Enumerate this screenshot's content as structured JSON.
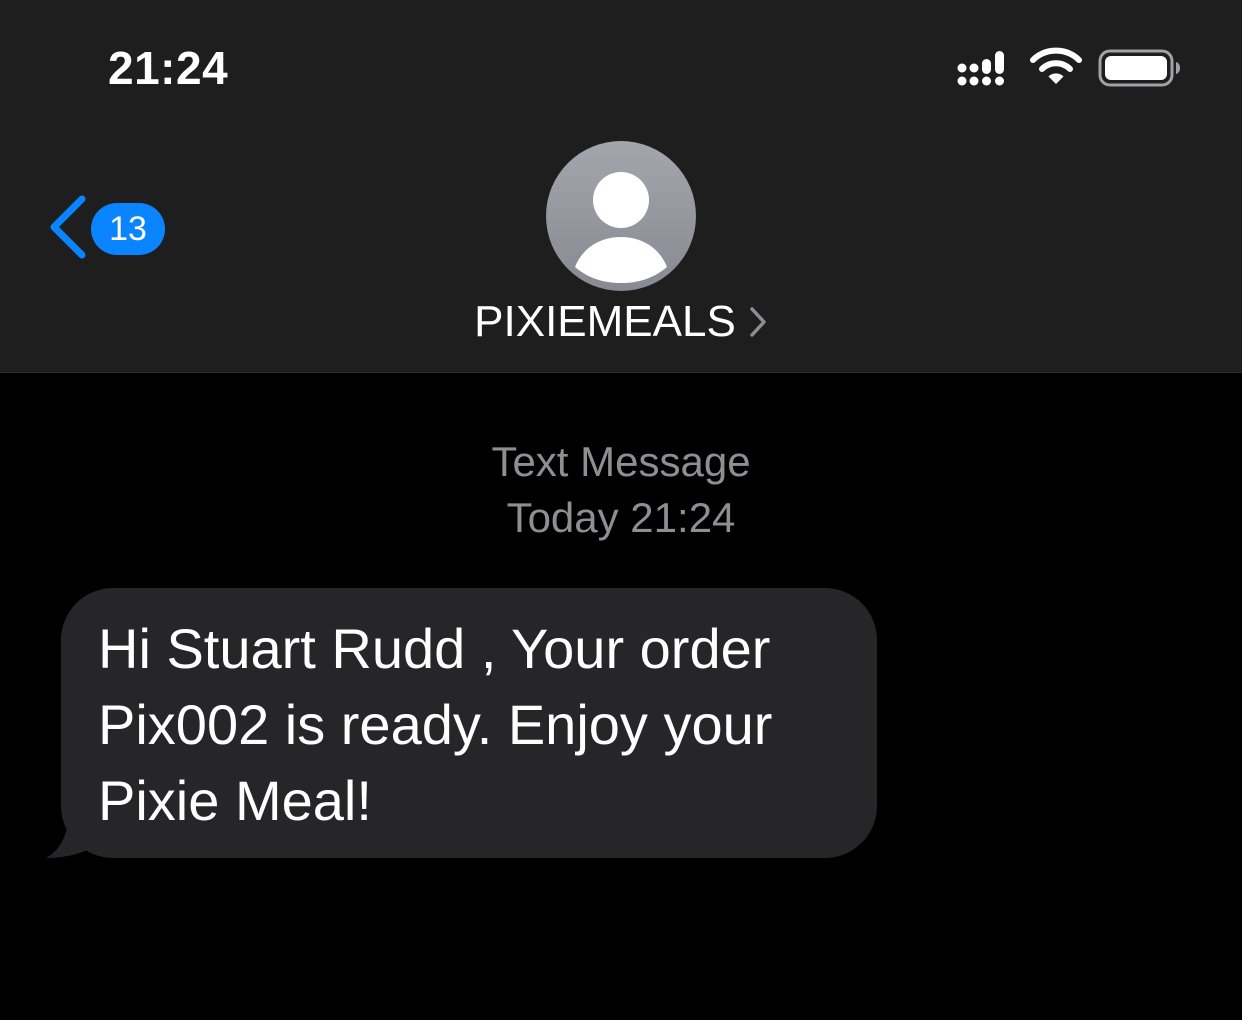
{
  "status_bar": {
    "time": "21:24",
    "icons": [
      "cellular-signal-icon",
      "wifi-icon",
      "battery-icon"
    ]
  },
  "nav": {
    "back_icon": "chevron-left-icon",
    "unread_count": "13",
    "contact_name": "PIXIEMEALS",
    "contact_avatar_icon": "person-silhouette-icon",
    "contact_detail_icon": "chevron-right-icon"
  },
  "conversation": {
    "service_label": "Text Message",
    "timestamp": "Today 21:24",
    "messages": [
      {
        "direction": "incoming",
        "text": "Hi Stuart Rudd , Your order Pix002 is ready. Enjoy your Pixie Meal!"
      }
    ]
  },
  "colors": {
    "header_background": "#1e1e1e",
    "screen_background": "#000000",
    "accent_blue": "#0a84ff",
    "incoming_bubble": "#262629",
    "secondary_text": "#8e8e93"
  }
}
